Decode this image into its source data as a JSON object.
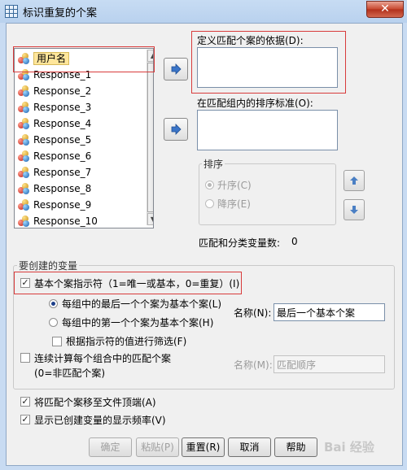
{
  "window": {
    "title": "标识重复的个案",
    "close_glyph": "✕"
  },
  "variables": {
    "items": [
      {
        "label": "用户名",
        "selected": true
      },
      {
        "label": "Response_1"
      },
      {
        "label": "Response_2"
      },
      {
        "label": "Response_3"
      },
      {
        "label": "Response_4"
      },
      {
        "label": "Response_5"
      },
      {
        "label": "Response_6"
      },
      {
        "label": "Response_7"
      },
      {
        "label": "Response_8"
      },
      {
        "label": "Response_9"
      },
      {
        "label": "Response_10"
      }
    ]
  },
  "match_cases": {
    "label": "定义匹配个案的依据(D):"
  },
  "sort_within": {
    "label": "在匹配组内的排序标准(O):"
  },
  "sort_order": {
    "legend": "排序",
    "ascending": "升序(C)",
    "descending": "降序(E)",
    "selected": "ascending"
  },
  "count_text": "匹配和分类变量数:",
  "count_value": "0",
  "create_vars": {
    "legend": "要创建的变量",
    "primary_indicator": "基本个案指示符（1=唯一或基本，0=重复）(I)",
    "last_case": "每组中的最后一个个案为基本个案(L)",
    "first_case": "每组中的第一个个案为基本个案(H)",
    "filter": "根据指示符的值进行筛选(F)",
    "name_label": "名称(N):",
    "name_value": "最后一个基本个案",
    "sequential_count": "连续计算每个组合中的匹配个案",
    "sequential_sub": "(0=非匹配个案)",
    "name2_label": "名称(M):",
    "name2_value": "匹配顺序"
  },
  "options": {
    "move_to_top": "将匹配个案移至文件顶端(A)",
    "show_frequency": "显示已创建变量的显示频率(V)"
  },
  "buttons": {
    "ok": "确定",
    "paste": "粘贴(P)",
    "reset": "重置(R)",
    "cancel": "取消",
    "help": "帮助"
  },
  "watermark": "Bai 经验",
  "icons": {
    "move_right": "arrow-right-icon",
    "move_up": "arrow-up-icon",
    "move_down": "arrow-down-icon",
    "variable": "nominal-variable-icon"
  },
  "colors": {
    "highlight": "#ffe69b",
    "annotation_red": "#d83b3b",
    "arrow_blue": "#3a74c7"
  }
}
